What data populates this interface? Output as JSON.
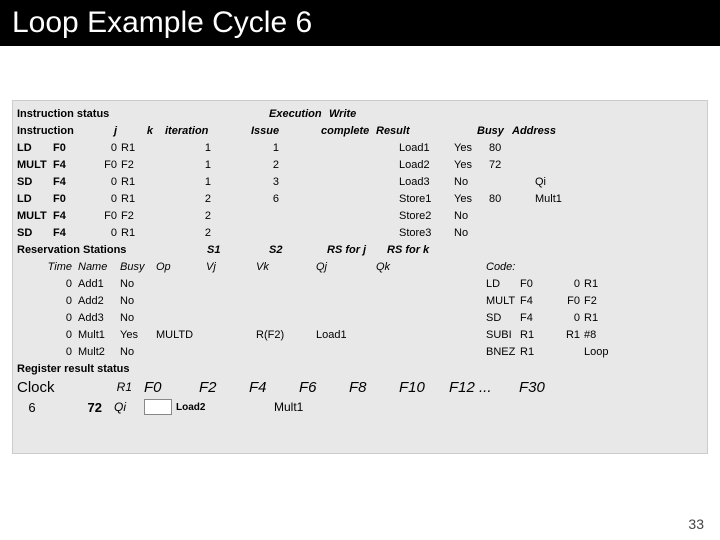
{
  "title": "Loop Example Cycle 6",
  "page_number": "33",
  "labels": {
    "instr_status": "Instruction status",
    "instruction": "Instruction",
    "j": "j",
    "k": "k",
    "iteration": "iteration",
    "issue": "Issue",
    "execution": "Execution",
    "complete": "complete",
    "write": "Write",
    "result": "Result",
    "busy": "Busy",
    "address": "Address",
    "reservation": "Reservation Stations",
    "s1": "S1",
    "s2": "S2",
    "rsj": "RS for j",
    "rsk": "RS for k",
    "time": "Time",
    "name": "Name",
    "op": "Op",
    "vj": "Vj",
    "vk": "Vk",
    "qj": "Qj",
    "qk": "Qk",
    "code": "Code:",
    "reg_status": "Register result status",
    "clock": "Clock",
    "r1": "R1",
    "qi": "Qi"
  },
  "instructions": [
    {
      "op": "LD",
      "dest": "F0",
      "j": "0",
      "k": "R1",
      "iter": "1",
      "issue": "1"
    },
    {
      "op": "MULT",
      "dest": "F4",
      "j": "F0",
      "k": "F2",
      "iter": "1",
      "issue": "2"
    },
    {
      "op": "SD",
      "dest": "F4",
      "j": "0",
      "k": "R1",
      "iter": "1",
      "issue": "3"
    },
    {
      "op": "LD",
      "dest": "F0",
      "j": "0",
      "k": "R1",
      "iter": "2",
      "issue": "6"
    },
    {
      "op": "MULT",
      "dest": "F4",
      "j": "F0",
      "k": "F2",
      "iter": "2",
      "issue": ""
    },
    {
      "op": "SD",
      "dest": "F4",
      "j": "0",
      "k": "R1",
      "iter": "2",
      "issue": ""
    }
  ],
  "load_store": [
    {
      "name": "Load1",
      "busy": "Yes",
      "addr": "80",
      "qi": ""
    },
    {
      "name": "Load2",
      "busy": "Yes",
      "addr": "72",
      "qi": ""
    },
    {
      "name": "Load3",
      "busy": "No",
      "addr": "",
      "qi": "Qi"
    },
    {
      "name": "Store1",
      "busy": "Yes",
      "addr": "80",
      "qi": "Mult1"
    },
    {
      "name": "Store2",
      "busy": "No",
      "addr": "",
      "qi": ""
    },
    {
      "name": "Store3",
      "busy": "No",
      "addr": "",
      "qi": ""
    }
  ],
  "rs": [
    {
      "time": "0",
      "name": "Add1",
      "busy": "No"
    },
    {
      "time": "0",
      "name": "Add2",
      "busy": "No"
    },
    {
      "time": "0",
      "name": "Add3",
      "busy": "No"
    },
    {
      "time": "0",
      "name": "Mult1",
      "busy": "Yes",
      "op": "MULTD",
      "vk": "R(F2)",
      "qj": "Load1"
    },
    {
      "time": "0",
      "name": "Mult2",
      "busy": "No"
    }
  ],
  "code": [
    {
      "op": "LD",
      "a": "F0",
      "b": "0",
      "c": "R1"
    },
    {
      "op": "MULT",
      "a": "F4",
      "b": "F0",
      "c": "F2"
    },
    {
      "op": "SD",
      "a": "F4",
      "b": "0",
      "c": "R1"
    },
    {
      "op": "SUBI",
      "a": "R1",
      "b": "R1",
      "c": "#8"
    },
    {
      "op": "BNEZ",
      "a": "R1",
      "b": "",
      "c": "Loop"
    }
  ],
  "registers": [
    "F0",
    "F2",
    "F4",
    "F6",
    "F8",
    "F10",
    "F12 ...",
    "F30"
  ],
  "reg_row": {
    "clock": "6",
    "r1": "72",
    "f0": "Load2",
    "f4": "Mult1"
  }
}
